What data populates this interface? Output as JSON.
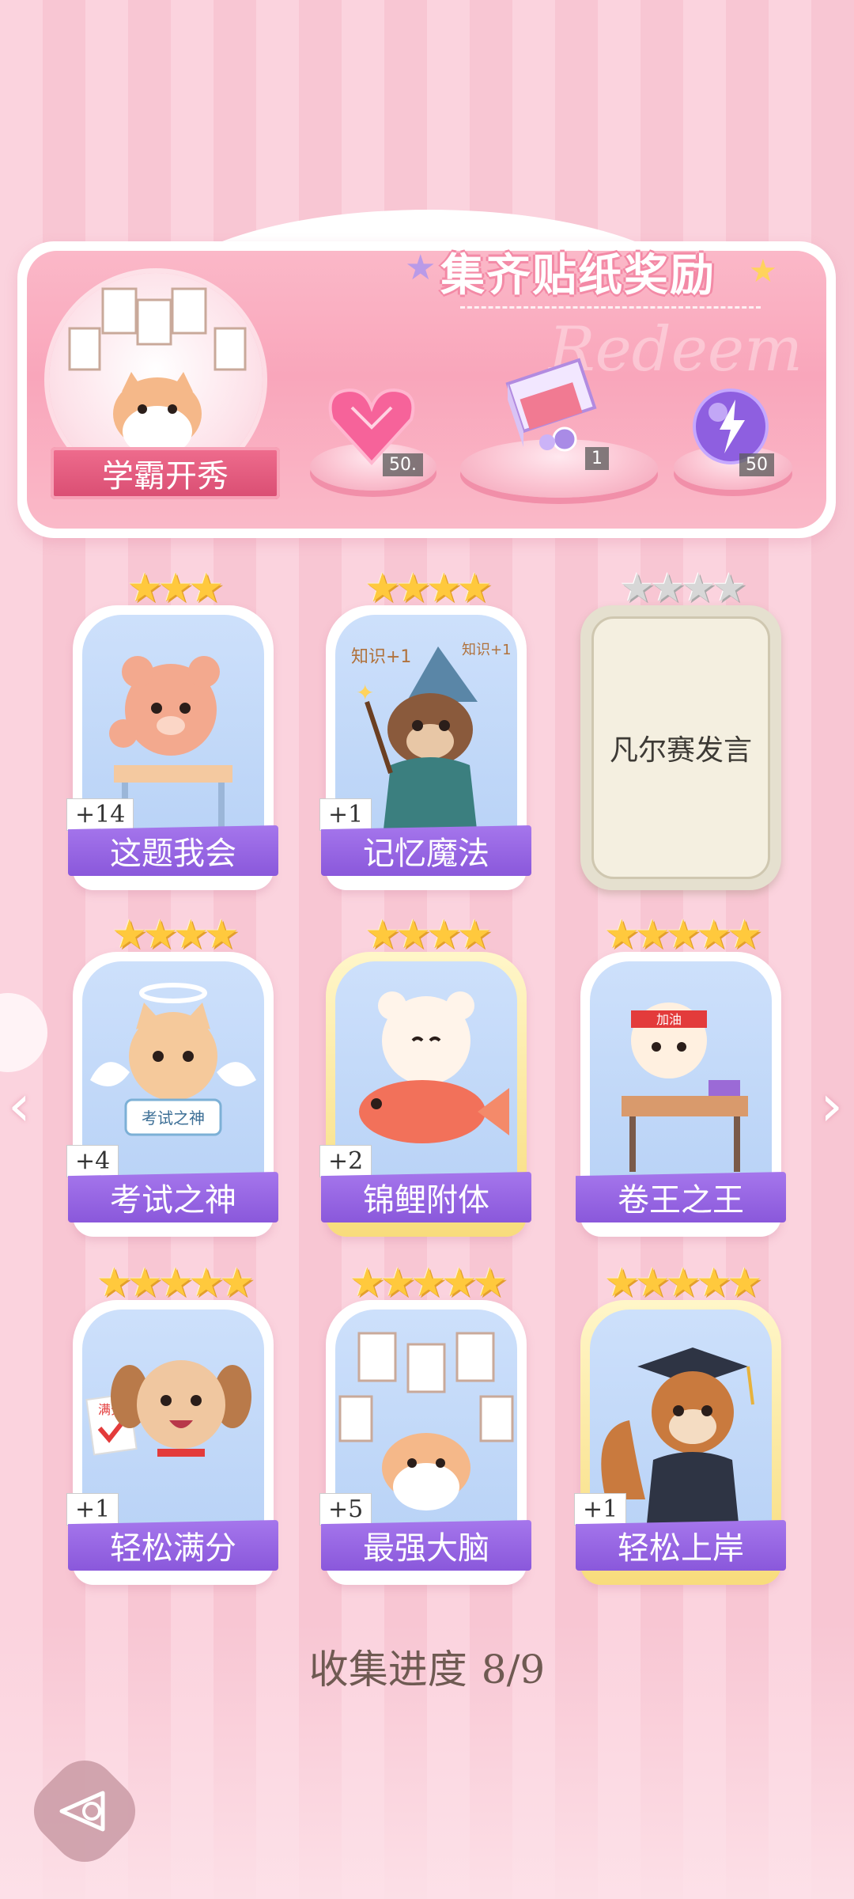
{
  "banner": {
    "title": "集齐贴纸奖励",
    "watermark": "Redeem",
    "medal_label": "学霸开秀",
    "rewards": [
      {
        "icon": "pink-heart-gem-icon",
        "count": "50."
      },
      {
        "icon": "gift-box-icon",
        "count": "1"
      },
      {
        "icon": "purple-energy-orb-icon",
        "count": "50"
      }
    ]
  },
  "cards": [
    {
      "label": "这题我会",
      "badge": "+14",
      "stars": 3,
      "art": "bear-at-desk"
    },
    {
      "label": "记忆魔法",
      "badge": "+1",
      "stars": 4,
      "art": "otter-wizard",
      "art_text": [
        "知识+1",
        "知识+1"
      ]
    },
    {
      "label": "凡尔赛发言",
      "stars": 4,
      "locked": true
    },
    {
      "label": "考试之神",
      "badge": "+4",
      "stars": 4,
      "art": "angel-cat",
      "art_text": [
        "考试之神"
      ]
    },
    {
      "label": "锦鲤附体",
      "badge": "+2",
      "stars": 4,
      "art": "bear-with-koi",
      "gold": true
    },
    {
      "label": "卷王之王",
      "stars": 5,
      "art": "cat-studying",
      "gold": false,
      "art_text": [
        "加油"
      ]
    },
    {
      "label": "轻松满分",
      "badge": "+1",
      "stars": 5,
      "art": "puppy-with-paper",
      "art_text": [
        "满分"
      ]
    },
    {
      "label": "最强大脑",
      "badge": "+5",
      "stars": 5,
      "art": "cat-with-papers"
    },
    {
      "label": "轻松上岸",
      "badge": "+1",
      "stars": 5,
      "art": "squirrel-graduate",
      "gold": true
    }
  ],
  "progress": {
    "label": "收集进度",
    "value": "8/9"
  },
  "icons": {
    "left": "chevron-left-icon",
    "right": "chevron-right-icon",
    "back": "back-icon"
  },
  "colors": {
    "label_purple": "#9565e2",
    "star_gold": "#ffc93d",
    "banner_pink": "#f9a6bb"
  }
}
